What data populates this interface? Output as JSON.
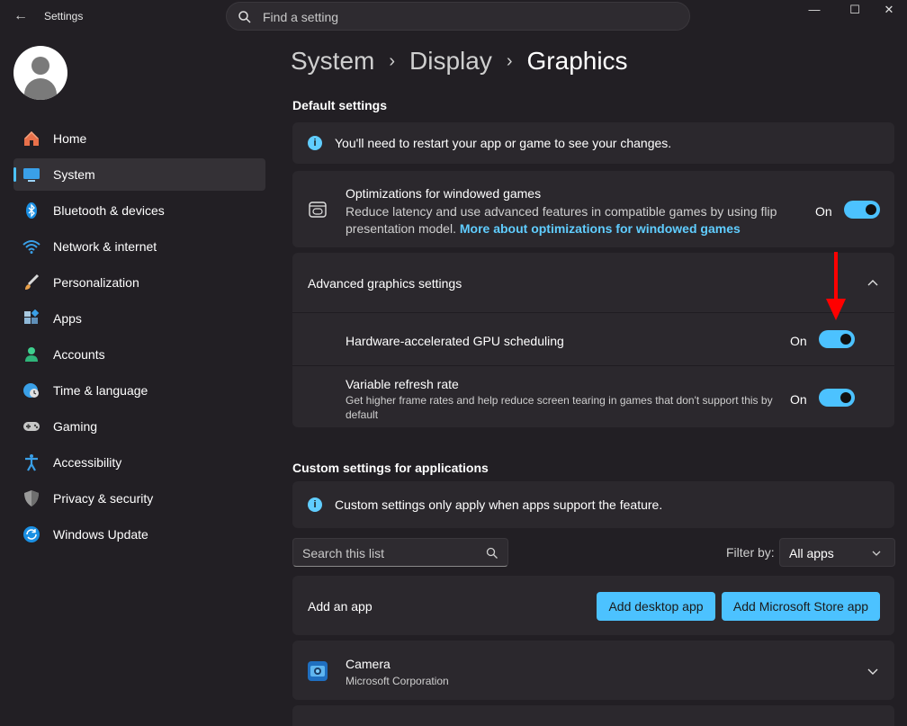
{
  "window": {
    "title": "Settings",
    "search_placeholder": "Find a setting",
    "minimize_label": "—",
    "maximize_label": "☐",
    "close_label": "✕"
  },
  "sidebar": {
    "items": [
      {
        "label": "Home",
        "icon": "home-icon",
        "active": false
      },
      {
        "label": "System",
        "icon": "system-monitor-icon",
        "active": true
      },
      {
        "label": "Bluetooth & devices",
        "icon": "bluetooth-icon",
        "active": false
      },
      {
        "label": "Network & internet",
        "icon": "wifi-icon",
        "active": false
      },
      {
        "label": "Personalization",
        "icon": "brush-icon",
        "active": false
      },
      {
        "label": "Apps",
        "icon": "apps-icon",
        "active": false
      },
      {
        "label": "Accounts",
        "icon": "accounts-icon",
        "active": false
      },
      {
        "label": "Time & language",
        "icon": "globe-clock-icon",
        "active": false
      },
      {
        "label": "Gaming",
        "icon": "gamepad-icon",
        "active": false
      },
      {
        "label": "Accessibility",
        "icon": "accessibility-icon",
        "active": false
      },
      {
        "label": "Privacy & security",
        "icon": "shield-icon",
        "active": false
      },
      {
        "label": "Windows Update",
        "icon": "update-icon",
        "active": false
      }
    ]
  },
  "breadcrumb": {
    "items": [
      "System",
      "Display",
      "Graphics"
    ],
    "separator": "›"
  },
  "default_settings": {
    "title": "Default settings",
    "info_text": "You'll need to restart your app or game to see your changes.",
    "windowed_games": {
      "title": "Optimizations for windowed games",
      "description": "Reduce latency and use advanced features in compatible games by using flip presentation model.",
      "link": "More about optimizations for windowed games",
      "state_label": "On",
      "enabled": true
    },
    "advanced": {
      "title": "Advanced graphics settings",
      "expanded": true,
      "gpu_scheduling": {
        "title": "Hardware-accelerated GPU scheduling",
        "state_label": "On",
        "enabled": true
      },
      "vrr": {
        "title": "Variable refresh rate",
        "description": "Get higher frame rates and help reduce screen tearing in games that don't support this by default",
        "state_label": "On",
        "enabled": true
      }
    }
  },
  "custom_settings": {
    "title": "Custom settings for applications",
    "info_text": "Custom settings only apply when apps support the feature.",
    "search_placeholder": "Search this list",
    "filter_label": "Filter by:",
    "filter_value": "All apps",
    "add_app_label": "Add an app",
    "add_desktop_label": "Add desktop app",
    "add_store_label": "Add Microsoft Store app",
    "apps": [
      {
        "name": "Camera",
        "publisher": "Microsoft Corporation",
        "icon": "camera-icon"
      }
    ]
  },
  "colors": {
    "accent": "#4cc2ff",
    "link": "#60cdff",
    "annotation_arrow": "#ff0000"
  }
}
